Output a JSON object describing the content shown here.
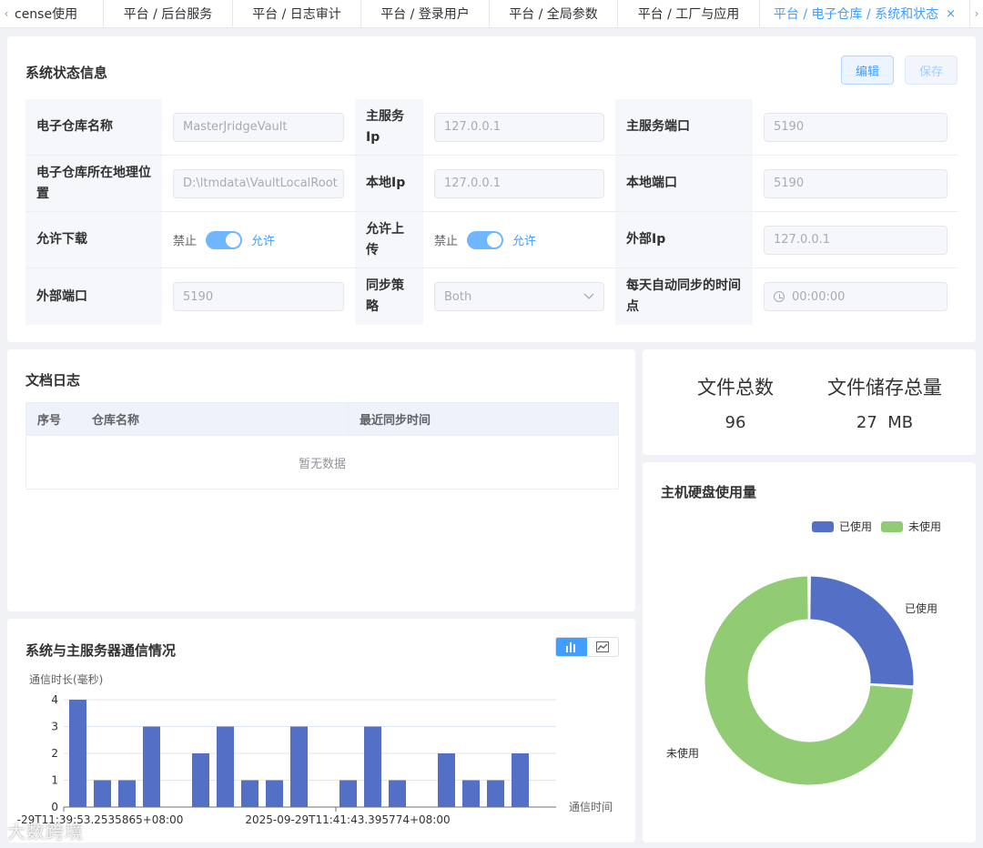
{
  "tabs": [
    {
      "label": "cense使用"
    },
    {
      "label": "平台 / 后台服务"
    },
    {
      "label": "平台 / 日志审计"
    },
    {
      "label": "平台 / 登录用户"
    },
    {
      "label": "平台 / 全局参数"
    },
    {
      "label": "平台 / 工厂与应用"
    },
    {
      "label": "平台 / 电子仓库 / 系统和状态",
      "active": true,
      "close": "×"
    }
  ],
  "system": {
    "title": "系统状态信息",
    "edit_label": "编辑",
    "save_label": "保存",
    "fields": {
      "vault_name": {
        "label": "电子仓库名称",
        "value": "MasterJridgeVault"
      },
      "main_ip": {
        "label": "主服务Ip",
        "value": "127.0.0.1"
      },
      "main_port": {
        "label": "主服务端口",
        "value": "5190"
      },
      "vault_location": {
        "label": "电子仓库所在地理位置",
        "value": "D:\\ltmdata\\VaultLocalRoot"
      },
      "local_ip": {
        "label": "本地Ip",
        "value": "127.0.0.1"
      },
      "local_port": {
        "label": "本地端口",
        "value": "5190"
      },
      "allow_download": {
        "label": "允许下载",
        "off": "禁止",
        "on": "允许",
        "enabled": true
      },
      "allow_upload": {
        "label": "允许上传",
        "off": "禁止",
        "on": "允许",
        "enabled": true
      },
      "external_ip": {
        "label": "外部Ip",
        "value": "127.0.0.1"
      },
      "external_port": {
        "label": "外部端口",
        "value": "5190"
      },
      "sync_strategy": {
        "label": "同步策略",
        "value": "Both"
      },
      "daily_sync_time": {
        "label": "每天自动同步的时间点",
        "value": "00:00:00"
      }
    }
  },
  "doc_log": {
    "title": "文档日志",
    "columns": [
      "序号",
      "仓库名称",
      "最近同步时间"
    ],
    "empty_text": "暂无数据"
  },
  "stats": {
    "file_count_label": "文件总数",
    "file_count_value": "96",
    "storage_label": "文件储存总量",
    "storage_value": "27  MB"
  },
  "disk": {
    "title": "主机硬盘使用量",
    "legend_used": "已使用",
    "legend_unused": "未使用",
    "label_used": "已使用",
    "label_unused": "未使用",
    "colors": {
      "used": "#5470c6",
      "unused": "#91cc75"
    }
  },
  "comm": {
    "title": "系统与主服务器通信情况",
    "toggle": [
      "bar-chart-icon",
      "line-chart-icon"
    ]
  },
  "chart_data": [
    {
      "type": "bar",
      "ylabel": "通信时长(毫秒)",
      "xlabel": "通信时间",
      "ylim": [
        0,
        4
      ],
      "yticks": [
        "0",
        "1",
        "2",
        "3",
        "4"
      ],
      "x_tick_labels": [
        "-29T11:39:53.2535865+08:00",
        "2025-09-29T11:41:43.395774+08:00"
      ],
      "color": "#5470c6",
      "values": [
        4,
        1,
        1,
        3,
        0,
        2,
        3,
        1,
        1,
        3,
        0,
        1,
        3,
        1,
        0,
        2,
        1,
        1,
        2
      ]
    },
    {
      "type": "pie",
      "variant": "donut",
      "slices": [
        {
          "name": "已使用",
          "value": 26
        },
        {
          "name": "未使用",
          "value": 74
        }
      ]
    }
  ],
  "watermark": "大数跨境"
}
